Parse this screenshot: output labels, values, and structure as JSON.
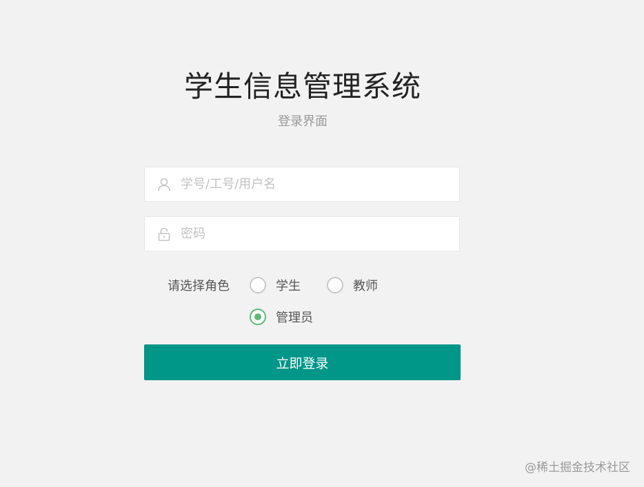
{
  "header": {
    "title": "学生信息管理系统",
    "subtitle": "登录界面"
  },
  "form": {
    "username": {
      "placeholder": "学号/工号/用户名",
      "value": "",
      "icon": "user-icon"
    },
    "password": {
      "placeholder": "密码",
      "value": "",
      "icon": "lock-icon"
    },
    "role": {
      "label": "请选择角色",
      "options": [
        {
          "label": "学生",
          "checked": false
        },
        {
          "label": "教师",
          "checked": false
        },
        {
          "label": "管理员",
          "checked": true
        }
      ]
    },
    "submit_label": "立即登录"
  },
  "colors": {
    "accent": "#009688",
    "radio_checked": "#5fb878",
    "background": "#f2f2f2"
  },
  "watermark": "@稀土掘金技术社区"
}
